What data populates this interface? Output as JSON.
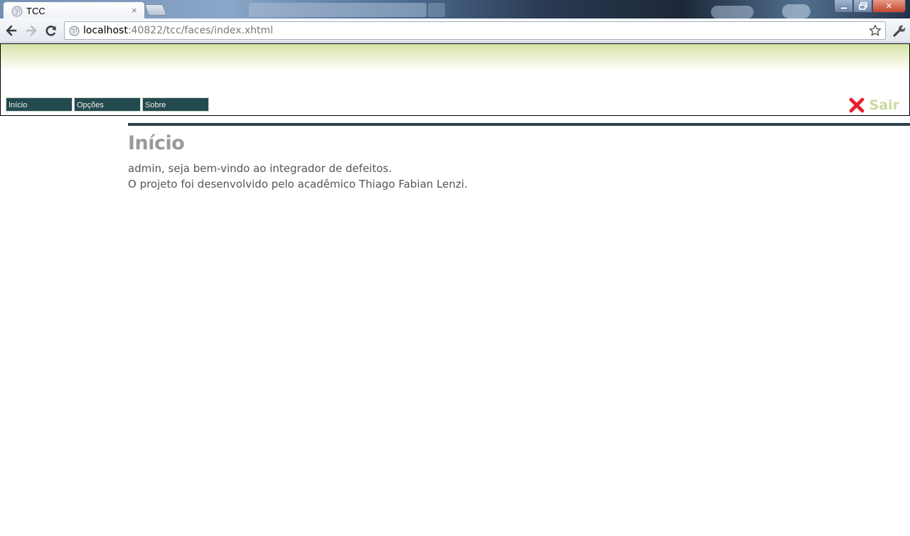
{
  "browser": {
    "tab_title": "TCC",
    "tab_close": "×",
    "url_host": "localhost",
    "url_rest": ":40822/tcc/faces/index.xhtml",
    "window_controls": {
      "minimize_icon": "minimize-icon",
      "maximize_icon": "restore-icon",
      "close_label": "✕"
    }
  },
  "header": {
    "menu": [
      {
        "label": "Início"
      },
      {
        "label": "Opções"
      },
      {
        "label": "Sobre"
      }
    ],
    "logout_label": "Sair"
  },
  "main": {
    "title": "Início",
    "line1": "admin, seja bem-vindo ao integrador de defeitos.",
    "line2": "O projeto foi desenvolvido pelo acadêmico Thiago Fabian Lenzi."
  },
  "colors": {
    "menu_bg": "#234a4f",
    "rule": "#2b4347",
    "logout_icon": "#e8202a",
    "logout_text": "#c9dba0",
    "header_gradient_top": "#d6e2a8"
  }
}
